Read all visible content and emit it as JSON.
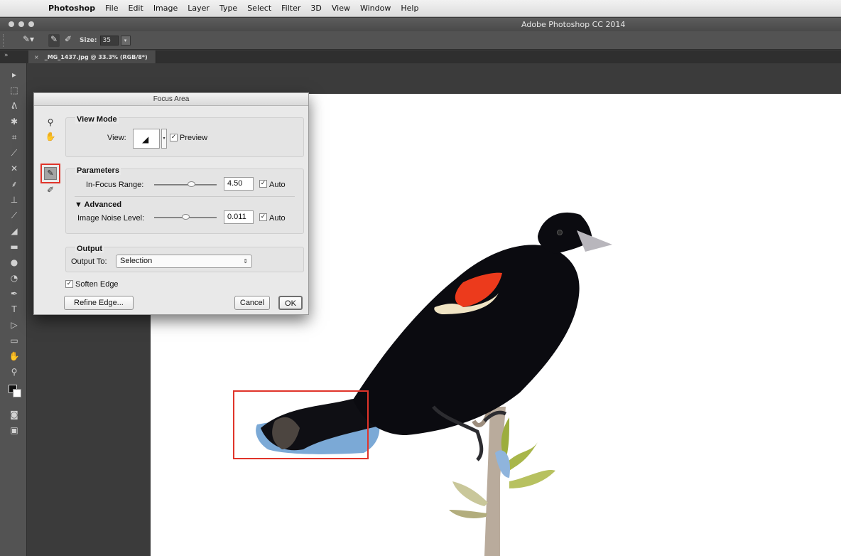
{
  "menubar": {
    "app": "Photoshop",
    "items": [
      "File",
      "Edit",
      "Image",
      "Layer",
      "Type",
      "Select",
      "Filter",
      "3D",
      "View",
      "Window",
      "Help"
    ]
  },
  "window": {
    "title": "Adobe Photoshop CC 2014"
  },
  "options_bar": {
    "size_label": "Size:",
    "size_value": "35"
  },
  "document_tab": {
    "close": "×",
    "label": "_MG_1437.jpg @ 33.3% (RGB/8*)"
  },
  "dialog": {
    "title": "Focus Area",
    "view_mode": {
      "title": "View Mode",
      "view_label": "View:",
      "preview_label": "Preview",
      "preview_checked": true
    },
    "parameters": {
      "title": "Parameters",
      "in_focus_label": "In-Focus Range:",
      "in_focus_value": "4.50",
      "in_focus_slider": 0.6,
      "in_focus_auto_label": "Auto",
      "advanced_title": "▼ Advanced",
      "noise_label": "Image Noise Level:",
      "noise_value": "0.011",
      "noise_slider": 0.5,
      "noise_auto_label": "Auto"
    },
    "output": {
      "title": "Output",
      "output_to_label": "Output To:",
      "output_to_value": "Selection"
    },
    "soften_edge_label": "Soften Edge",
    "refine_edge_button": "Refine Edge...",
    "cancel_button": "Cancel",
    "ok_button": "OK"
  },
  "colors": {
    "highlight_red": "#e0342a",
    "canvas_bg": "#ffffff",
    "ui_dark": "#3b3b3b"
  },
  "icons": [
    "apple-icon",
    "zoom-icon",
    "hand-icon",
    "focus-add-brush-icon",
    "focus-subtract-brush-icon",
    "bird-icon"
  ]
}
